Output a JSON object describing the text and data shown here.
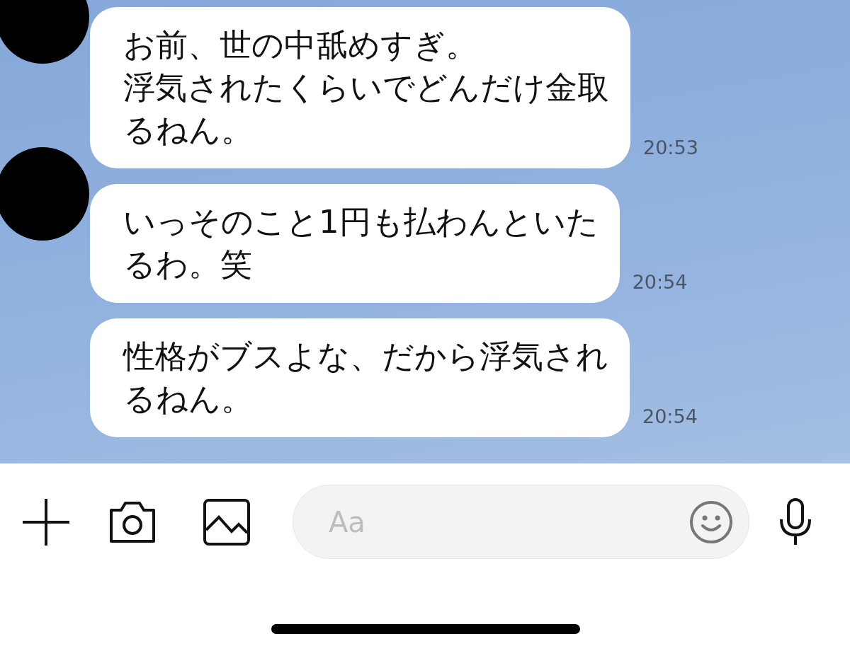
{
  "messages": [
    {
      "lines": [
        "お前、世の中舐めすぎ。",
        "浮気されたくらいでどんだけ金取",
        "るねん。"
      ],
      "time": "20:53",
      "avatar": true
    },
    {
      "lines": [
        "いっそのこと1円も払わんといた",
        "るわ。笑"
      ],
      "time": "20:54",
      "avatar": true
    },
    {
      "lines": [
        "性格がブスよな、だから浮気され",
        "るねん。"
      ],
      "time": "20:54",
      "avatar": false
    }
  ],
  "input": {
    "placeholder": "Aa"
  }
}
